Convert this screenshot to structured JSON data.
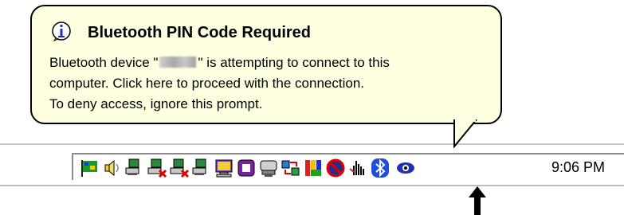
{
  "balloon": {
    "title": "Bluetooth PIN Code Required",
    "line1_a": "Bluetooth device \"",
    "line1_b": "\" is attempting to connect to this",
    "line2": "computer.  Click here to proceed with the connection.",
    "line3": "To deny access, ignore this prompt."
  },
  "tray": {
    "icons": [
      "flag-icon",
      "speaker-icon",
      "network-icon",
      "network-disconnected-icon",
      "network-disconnected-icon",
      "network-icon",
      "monitor-icon",
      "app-icon",
      "drive-icon",
      "sync-icon",
      "color-icon",
      "antivirus-icon",
      "hand-icon",
      "bluetooth-icon",
      "eye-icon"
    ],
    "clock": "9:06 PM"
  },
  "colors": {
    "balloon_bg": "#ffffe1",
    "bluetooth_blue": "#1d4fd8"
  }
}
